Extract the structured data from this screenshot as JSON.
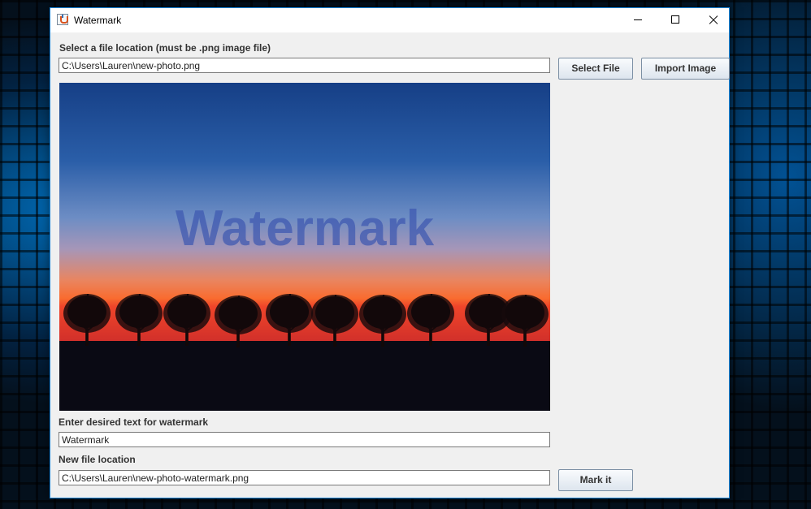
{
  "window": {
    "title": "Watermark",
    "controls": {
      "minimize": "minimize",
      "maximize": "maximize",
      "close": "close"
    }
  },
  "file_select": {
    "label": "Select a file location (must be .png image file)",
    "value": "C:\\Users\\Lauren\\new-photo.png",
    "select_button": "Select File",
    "import_button": "Import Image"
  },
  "preview": {
    "watermark_overlay": "Watermark",
    "colors": {
      "sky_top": "#163f86",
      "sky_bottom": "#f96c2f",
      "ground": "#0a0a14"
    }
  },
  "watermark_text": {
    "label": "Enter desired text for watermark",
    "value": "Watermark"
  },
  "output": {
    "label": "New file location",
    "value": "C:\\Users\\Lauren\\new-photo-watermark.png",
    "mark_button": "Mark it"
  }
}
